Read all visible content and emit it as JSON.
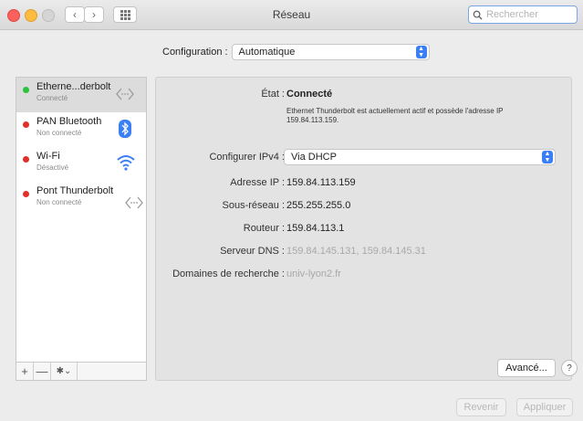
{
  "window": {
    "title": "Réseau"
  },
  "search": {
    "placeholder": "Rechercher",
    "icon": "search-icon"
  },
  "toolbar": {
    "back_icon": "‹",
    "forward_icon": "›"
  },
  "configuration": {
    "label": "Configuration :",
    "value": "Automatique"
  },
  "services": [
    {
      "name": "Etherne...derbolt",
      "status": "Connecté",
      "dot_color": "#2bc23c",
      "icon": "ethernet-icon"
    },
    {
      "name": "PAN Bluetooth",
      "status": "Non connecté",
      "dot_color": "#e0302a",
      "icon": "bluetooth-icon"
    },
    {
      "name": "Wi-Fi",
      "status": "Désactivé",
      "dot_color": "#e0302a",
      "icon": "wifi-icon"
    },
    {
      "name": "Pont Thunderbolt",
      "status": "Non connecté",
      "dot_color": "#e0302a",
      "icon": "ethernet-icon"
    }
  ],
  "sidebar_controls": {
    "add": "+",
    "remove": "—",
    "action": "✱⌄"
  },
  "details": {
    "state_label": "État :",
    "state_value": "Connecté",
    "state_description": "Ethernet Thunderbolt est actuellement actif et possède l'adresse IP 159.84.113.159.",
    "ipv4_label": "Configurer IPv4 :",
    "ipv4_value": "Via DHCP",
    "ip_label": "Adresse IP :",
    "ip_value": "159.84.113.159",
    "subnet_label": "Sous-réseau :",
    "subnet_value": "255.255.255.0",
    "router_label": "Routeur :",
    "router_value": "159.84.113.1",
    "dns_label": "Serveur DNS :",
    "dns_value": "159.84.145.131, 159.84.145.31",
    "search_domains_label": "Domaines de recherche :",
    "search_domains_value": "univ-lyon2.fr"
  },
  "buttons": {
    "advanced": "Avancé...",
    "help": "?",
    "revert": "Revenir",
    "apply": "Appliquer"
  },
  "colors": {
    "accent": "#3a7ff5",
    "connected": "#2bc23c",
    "disconnected": "#e0302a"
  }
}
